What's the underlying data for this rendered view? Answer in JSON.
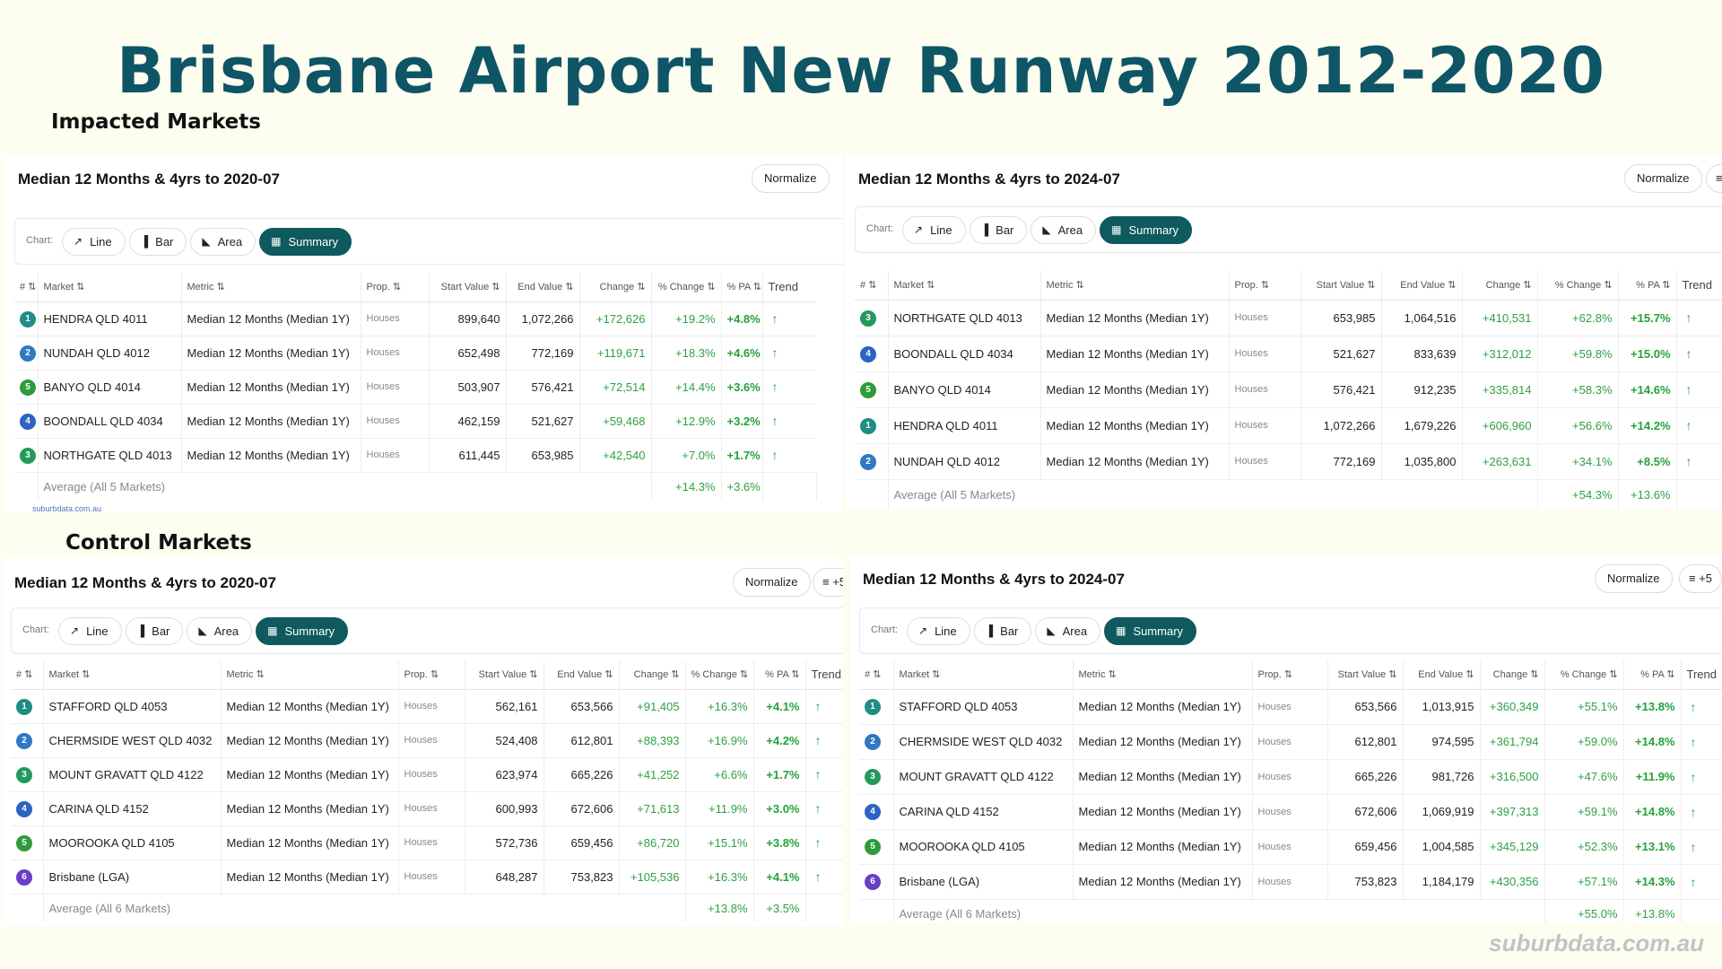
{
  "page": {
    "title": "Brisbane Airport New Runway 2012-2020",
    "impacted_label": "Impacted Markets",
    "control_label": "Control Markets",
    "footer_brand": "suburbdata.com.au",
    "small_source": "suburbdata.com.au"
  },
  "ui": {
    "normalize": "Normalize",
    "layers_badge": "+5",
    "chart_label": "Chart:",
    "chips": [
      "Line",
      "Bar",
      "Area",
      "Summary"
    ],
    "headers": [
      "#",
      "Market",
      "Metric",
      "Prop.",
      "Start Value",
      "End Value",
      "Change",
      "% Change",
      "% PA",
      "Trend"
    ]
  },
  "colors": {
    "rank_1": "#1f8e85",
    "rank_2": "#2f78c4",
    "rank_3": "#239a5c",
    "rank_4": "#2c63c4",
    "rank_5": "#2e9b3a",
    "rank_6": "#6b3fc4"
  },
  "panels": {
    "imp2020": {
      "title": "Median 12 Months & 4yrs to 2020-07",
      "rows": [
        {
          "rank": "1",
          "market": "HENDRA QLD 4011",
          "metric": "Median 12 Months (Median 1Y)",
          "prop": "Houses",
          "start": "899,640",
          "end": "1,072,266",
          "change": "+172,626",
          "pct": "+19.2%",
          "pa": "+4.8%",
          "trend": "↑"
        },
        {
          "rank": "2",
          "market": "NUNDAH QLD 4012",
          "metric": "Median 12 Months (Median 1Y)",
          "prop": "Houses",
          "start": "652,498",
          "end": "772,169",
          "change": "+119,671",
          "pct": "+18.3%",
          "pa": "+4.6%",
          "trend": "↑"
        },
        {
          "rank": "5",
          "market": "BANYO QLD 4014",
          "metric": "Median 12 Months (Median 1Y)",
          "prop": "Houses",
          "start": "503,907",
          "end": "576,421",
          "change": "+72,514",
          "pct": "+14.4%",
          "pa": "+3.6%",
          "trend": "↑"
        },
        {
          "rank": "4",
          "market": "BOONDALL QLD 4034",
          "metric": "Median 12 Months (Median 1Y)",
          "prop": "Houses",
          "start": "462,159",
          "end": "521,627",
          "change": "+59,468",
          "pct": "+12.9%",
          "pa": "+3.2%",
          "trend": "↑"
        },
        {
          "rank": "3",
          "market": "NORTHGATE QLD 4013",
          "metric": "Median 12 Months (Median 1Y)",
          "prop": "Houses",
          "start": "611,445",
          "end": "653,985",
          "change": "+42,540",
          "pct": "+7.0%",
          "pa": "+1.7%",
          "trend": "↑"
        }
      ],
      "avg": {
        "label": "Average (All 5 Markets)",
        "pct": "+14.3%",
        "pa": "+3.6%"
      }
    },
    "imp2024": {
      "title": "Median 12 Months & 4yrs to 2024-07",
      "rows": [
        {
          "rank": "3",
          "market": "NORTHGATE QLD 4013",
          "metric": "Median 12 Months (Median 1Y)",
          "prop": "Houses",
          "start": "653,985",
          "end": "1,064,516",
          "change": "+410,531",
          "pct": "+62.8%",
          "pa": "+15.7%",
          "trend": "↑"
        },
        {
          "rank": "4",
          "market": "BOONDALL QLD 4034",
          "metric": "Median 12 Months (Median 1Y)",
          "prop": "Houses",
          "start": "521,627",
          "end": "833,639",
          "change": "+312,012",
          "pct": "+59.8%",
          "pa": "+15.0%",
          "trend": "↑"
        },
        {
          "rank": "5",
          "market": "BANYO QLD 4014",
          "metric": "Median 12 Months (Median 1Y)",
          "prop": "Houses",
          "start": "576,421",
          "end": "912,235",
          "change": "+335,814",
          "pct": "+58.3%",
          "pa": "+14.6%",
          "trend": "↑"
        },
        {
          "rank": "1",
          "market": "HENDRA QLD 4011",
          "metric": "Median 12 Months (Median 1Y)",
          "prop": "Houses",
          "start": "1,072,266",
          "end": "1,679,226",
          "change": "+606,960",
          "pct": "+56.6%",
          "pa": "+14.2%",
          "trend": "↑"
        },
        {
          "rank": "2",
          "market": "NUNDAH QLD 4012",
          "metric": "Median 12 Months (Median 1Y)",
          "prop": "Houses",
          "start": "772,169",
          "end": "1,035,800",
          "change": "+263,631",
          "pct": "+34.1%",
          "pa": "+8.5%",
          "trend": "↑"
        }
      ],
      "avg": {
        "label": "Average (All 5 Markets)",
        "pct": "+54.3%",
        "pa": "+13.6%"
      }
    },
    "ctl2020": {
      "title": "Median 12 Months & 4yrs to 2020-07",
      "rows": [
        {
          "rank": "1",
          "market": "STAFFORD QLD 4053",
          "metric": "Median 12 Months (Median 1Y)",
          "prop": "Houses",
          "start": "562,161",
          "end": "653,566",
          "change": "+91,405",
          "pct": "+16.3%",
          "pa": "+4.1%",
          "trend": "↑"
        },
        {
          "rank": "2",
          "market": "CHERMSIDE WEST QLD 4032",
          "metric": "Median 12 Months (Median 1Y)",
          "prop": "Houses",
          "start": "524,408",
          "end": "612,801",
          "change": "+88,393",
          "pct": "+16.9%",
          "pa": "+4.2%",
          "trend": "↑"
        },
        {
          "rank": "3",
          "market": "MOUNT GRAVATT QLD 4122",
          "metric": "Median 12 Months (Median 1Y)",
          "prop": "Houses",
          "start": "623,974",
          "end": "665,226",
          "change": "+41,252",
          "pct": "+6.6%",
          "pa": "+1.7%",
          "trend": "↑"
        },
        {
          "rank": "4",
          "market": "CARINA QLD 4152",
          "metric": "Median 12 Months (Median 1Y)",
          "prop": "Houses",
          "start": "600,993",
          "end": "672,606",
          "change": "+71,613",
          "pct": "+11.9%",
          "pa": "+3.0%",
          "trend": "↑"
        },
        {
          "rank": "5",
          "market": "MOOROOKA QLD 4105",
          "metric": "Median 12 Months (Median 1Y)",
          "prop": "Houses",
          "start": "572,736",
          "end": "659,456",
          "change": "+86,720",
          "pct": "+15.1%",
          "pa": "+3.8%",
          "trend": "↑"
        },
        {
          "rank": "6",
          "market": "Brisbane (LGA)",
          "metric": "Median 12 Months (Median 1Y)",
          "prop": "Houses",
          "start": "648,287",
          "end": "753,823",
          "change": "+105,536",
          "pct": "+16.3%",
          "pa": "+4.1%",
          "trend": "↑"
        }
      ],
      "avg": {
        "label": "Average (All 6 Markets)",
        "pct": "+13.8%",
        "pa": "+3.5%"
      }
    },
    "ctl2024": {
      "title": "Median 12 Months & 4yrs to 2024-07",
      "rows": [
        {
          "rank": "1",
          "market": "STAFFORD QLD 4053",
          "metric": "Median 12 Months (Median 1Y)",
          "prop": "Houses",
          "start": "653,566",
          "end": "1,013,915",
          "change": "+360,349",
          "pct": "+55.1%",
          "pa": "+13.8%",
          "trend": "↑"
        },
        {
          "rank": "2",
          "market": "CHERMSIDE WEST QLD 4032",
          "metric": "Median 12 Months (Median 1Y)",
          "prop": "Houses",
          "start": "612,801",
          "end": "974,595",
          "change": "+361,794",
          "pct": "+59.0%",
          "pa": "+14.8%",
          "trend": "↑"
        },
        {
          "rank": "3",
          "market": "MOUNT GRAVATT QLD 4122",
          "metric": "Median 12 Months (Median 1Y)",
          "prop": "Houses",
          "start": "665,226",
          "end": "981,726",
          "change": "+316,500",
          "pct": "+47.6%",
          "pa": "+11.9%",
          "trend": "↑"
        },
        {
          "rank": "4",
          "market": "CARINA QLD 4152",
          "metric": "Median 12 Months (Median 1Y)",
          "prop": "Houses",
          "start": "672,606",
          "end": "1,069,919",
          "change": "+397,313",
          "pct": "+59.1%",
          "pa": "+14.8%",
          "trend": "↑"
        },
        {
          "rank": "5",
          "market": "MOOROOKA QLD 4105",
          "metric": "Median 12 Months (Median 1Y)",
          "prop": "Houses",
          "start": "659,456",
          "end": "1,004,585",
          "change": "+345,129",
          "pct": "+52.3%",
          "pa": "+13.1%",
          "trend": "↑"
        },
        {
          "rank": "6",
          "market": "Brisbane (LGA)",
          "metric": "Median 12 Months (Median 1Y)",
          "prop": "Houses",
          "start": "753,823",
          "end": "1,184,179",
          "change": "+430,356",
          "pct": "+57.1%",
          "pa": "+14.3%",
          "trend": "↑"
        }
      ],
      "avg": {
        "label": "Average (All 6 Markets)",
        "pct": "+55.0%",
        "pa": "+13.8%"
      }
    }
  }
}
